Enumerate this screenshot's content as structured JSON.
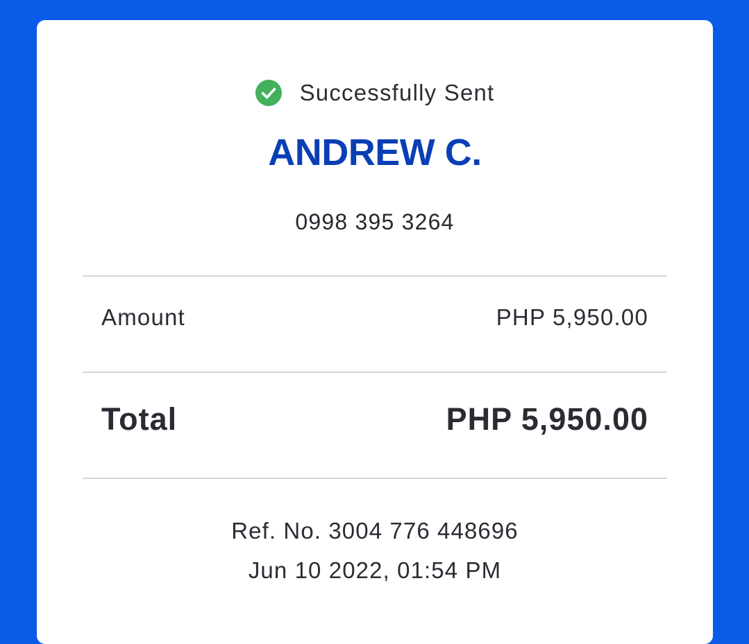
{
  "receipt": {
    "status_text": "Successfully Sent",
    "status_icon": "check-circle-icon",
    "recipient_name": "ANDREW C.",
    "recipient_number": "0998 395 3264",
    "amount_label": "Amount",
    "amount_value": "PHP 5,950.00",
    "total_label": "Total",
    "total_value": "PHP 5,950.00",
    "ref_no": "Ref. No. 3004 776 448696",
    "datetime": "Jun 10 2022, 01:54 PM"
  },
  "colors": {
    "background": "#0a5ce8",
    "card": "#ffffff",
    "recipient_name": "#0a3fb4",
    "success_green": "#43b05c",
    "divider": "#d7d8dc",
    "text": "#2a2c33"
  }
}
